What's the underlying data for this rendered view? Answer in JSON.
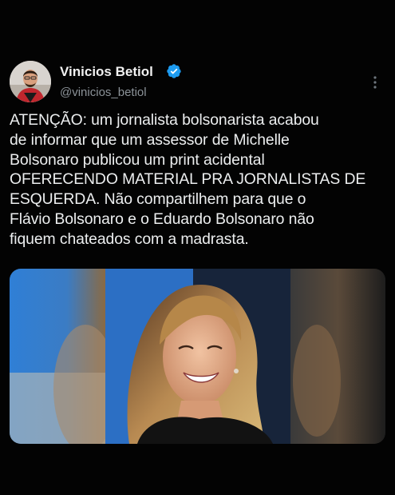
{
  "tweet": {
    "author": {
      "display_name": "Vinicios Betiol",
      "handle": "@vinicios_betiol",
      "verified": true,
      "avatar_icon": "user-avatar"
    },
    "text": "ATENÇÃO: um jornalista bolsonarista acabou\nde informar que um assessor de Michelle\nBolsonaro publicou um print acidental\nOFERECENDO MATERIAL PRA JORNALISTAS DE\nESQUERDA. Não compartilhem para que o\nFlávio Bolsonaro e o Eduardo Bolsonaro não\nfiquem chateados com a madrasta.",
    "menu_icon": "more-options-icon",
    "media": {
      "type": "photo"
    }
  },
  "colors": {
    "background": "#000000",
    "text": "#e7e9ea",
    "secondary_text": "#8b9298",
    "verified_badge": "#1d9bf0"
  }
}
